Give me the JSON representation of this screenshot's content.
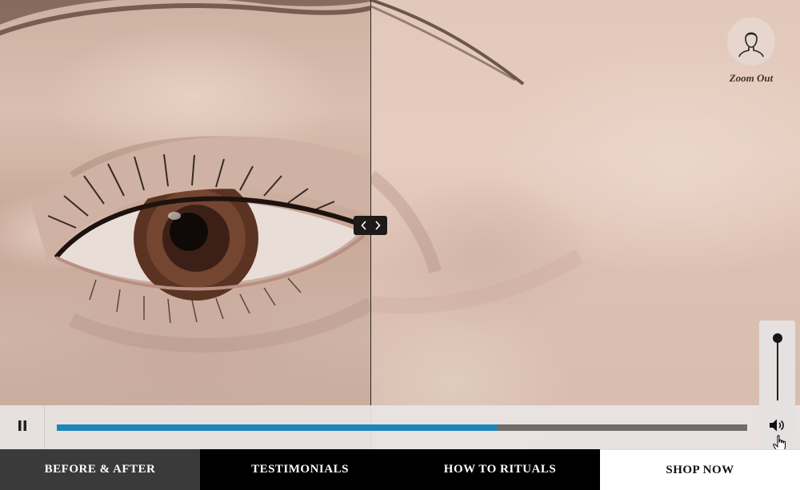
{
  "video": {
    "zoom_out": {
      "label": "Zoom Out",
      "icon": "face-outline-icon"
    },
    "comparison_handle": {
      "icon_left": "chevron-left-icon",
      "icon_right": "chevron-right-icon"
    },
    "controls": {
      "play_pause_icon": "pause-icon",
      "progress_fraction": 0.637,
      "volume_icon": "speaker-icon",
      "volume_level": 1.0,
      "accent_color": "#1b87b8"
    }
  },
  "nav": {
    "items": [
      {
        "label": "BEFORE & AFTER",
        "active": true
      },
      {
        "label": "TESTIMONIALS",
        "active": false
      },
      {
        "label": "HOW TO RITUALS",
        "active": false
      },
      {
        "label": "SHOP NOW",
        "active": false
      }
    ]
  }
}
